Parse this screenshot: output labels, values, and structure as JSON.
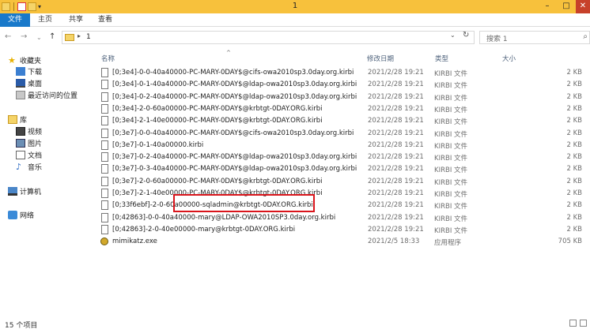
{
  "window": {
    "title": "1"
  },
  "controls": {
    "minimize": "–",
    "maximize": "□",
    "close": "✕"
  },
  "ribbon": {
    "tabs": [
      "文件",
      "主页",
      "共享",
      "查看"
    ]
  },
  "nav": {
    "back": "←",
    "forward": "→",
    "dropdown": "⌄",
    "up": "↑"
  },
  "address": {
    "path": "1"
  },
  "search": {
    "placeholder": "搜索 1"
  },
  "sidebar": {
    "favorites": "收藏夹",
    "favorites_items": [
      "下载",
      "桌面",
      "最近访问的位置"
    ],
    "libraries": "库",
    "library_items": [
      "视频",
      "图片",
      "文档",
      "音乐"
    ],
    "computer": "计算机",
    "network": "网络"
  },
  "columns": {
    "name": "名称",
    "date": "修改日期",
    "type": "类型",
    "size": "大小"
  },
  "files": [
    {
      "name": "[0;3e4]-0-0-40a40000-PC-MARY-0DAY$@cifs-owa2010sp3.0day.org.kirbi",
      "date": "2021/2/28 19:21",
      "type": "KIRBI 文件",
      "size": "2 KB"
    },
    {
      "name": "[0;3e4]-0-1-40a40000-PC-MARY-0DAY$@ldap-owa2010sp3.0day.org.kirbi",
      "date": "2021/2/28 19:21",
      "type": "KIRBI 文件",
      "size": "2 KB"
    },
    {
      "name": "[0;3e4]-0-2-40a40000-PC-MARY-0DAY$@ldap-owa2010sp3.0day.org.kirbi",
      "date": "2021/2/28 19:21",
      "type": "KIRBI 文件",
      "size": "2 KB"
    },
    {
      "name": "[0;3e4]-2-0-60a00000-PC-MARY-0DAY$@krbtgt-0DAY.ORG.kirbi",
      "date": "2021/2/28 19:21",
      "type": "KIRBI 文件",
      "size": "2 KB"
    },
    {
      "name": "[0;3e4]-2-1-40e00000-PC-MARY-0DAY$@krbtgt-0DAY.ORG.kirbi",
      "date": "2021/2/28 19:21",
      "type": "KIRBI 文件",
      "size": "2 KB"
    },
    {
      "name": "[0;3e7]-0-0-40a40000-PC-MARY-0DAY$@cifs-owa2010sp3.0day.org.kirbi",
      "date": "2021/2/28 19:21",
      "type": "KIRBI 文件",
      "size": "2 KB"
    },
    {
      "name": "[0;3e7]-0-1-40a00000.kirbi",
      "date": "2021/2/28 19:21",
      "type": "KIRBI 文件",
      "size": "2 KB"
    },
    {
      "name": "[0;3e7]-0-2-40a40000-PC-MARY-0DAY$@ldap-owa2010sp3.0day.org.kirbi",
      "date": "2021/2/28 19:21",
      "type": "KIRBI 文件",
      "size": "2 KB"
    },
    {
      "name": "[0;3e7]-0-3-40a40000-PC-MARY-0DAY$@ldap-owa2010sp3.0day.org.kirbi",
      "date": "2021/2/28 19:21",
      "type": "KIRBI 文件",
      "size": "2 KB"
    },
    {
      "name": "[0;3e7]-2-0-60a00000-PC-MARY-0DAY$@krbtgt-0DAY.ORG.kirbi",
      "date": "2021/2/28 19:21",
      "type": "KIRBI 文件",
      "size": "2 KB"
    },
    {
      "name": "[0;3e7]-2-1-40e00000-PC-MARY-0DAY$@krbtgt-0DAY.ORG.kirbi",
      "date": "2021/2/28 19:21",
      "type": "KIRBI 文件",
      "size": "2 KB"
    },
    {
      "name": "[0;33f6ebf]-2-0-60a00000-sqladmin@krbtgt-0DAY.ORG.kirbi",
      "date": "2021/2/28 19:21",
      "type": "KIRBI 文件",
      "size": "2 KB"
    },
    {
      "name": "[0;42863]-0-0-40a40000-mary@LDAP-OWA2010SP3.0day.org.kirbi",
      "date": "2021/2/28 19:21",
      "type": "KIRBI 文件",
      "size": "2 KB"
    },
    {
      "name": "[0;42863]-2-0-40e00000-mary@krbtgt-0DAY.ORG.kirbi",
      "date": "2021/2/28 19:21",
      "type": "KIRBI 文件",
      "size": "2 KB"
    },
    {
      "name": "mimikatz.exe",
      "date": "2021/2/5 18:33",
      "type": "应用程序",
      "size": "705 KB"
    }
  ],
  "status": {
    "count": "15 个项目"
  }
}
